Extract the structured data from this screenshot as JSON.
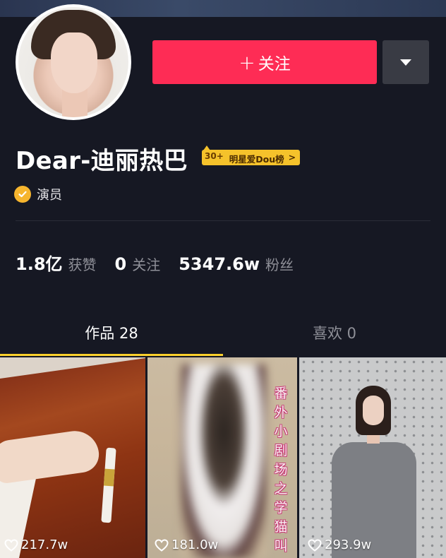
{
  "profile": {
    "username": "Dear-迪丽热巴",
    "rank_number": "30+",
    "rank_label": "明星爱Dou榜",
    "rank_chevron": ">",
    "verified_text": "演员"
  },
  "actions": {
    "follow_plus": "+",
    "follow_label": "关注"
  },
  "stats": [
    {
      "value": "1.8亿",
      "label": "获赞"
    },
    {
      "value": "0",
      "label": "关注"
    },
    {
      "value": "5347.6w",
      "label": "粉丝"
    }
  ],
  "tabs": [
    {
      "label": "作品 28",
      "active": true
    },
    {
      "label": "喜欢 0",
      "active": false
    }
  ],
  "videos": [
    {
      "likes": "217.7w"
    },
    {
      "likes": "181.0w",
      "overlay_text": "番外小剧场之学猫叫"
    },
    {
      "likes": "293.9w"
    }
  ],
  "colors": {
    "background": "#161823",
    "follow_button": "#fe2c55",
    "tab_underline": "#fbd02c",
    "verified": "#f6b52e",
    "rank_badge": "#f5c22b"
  },
  "icons": [
    "verified-check-icon",
    "caret-down-icon",
    "heart-outline-icon"
  ]
}
